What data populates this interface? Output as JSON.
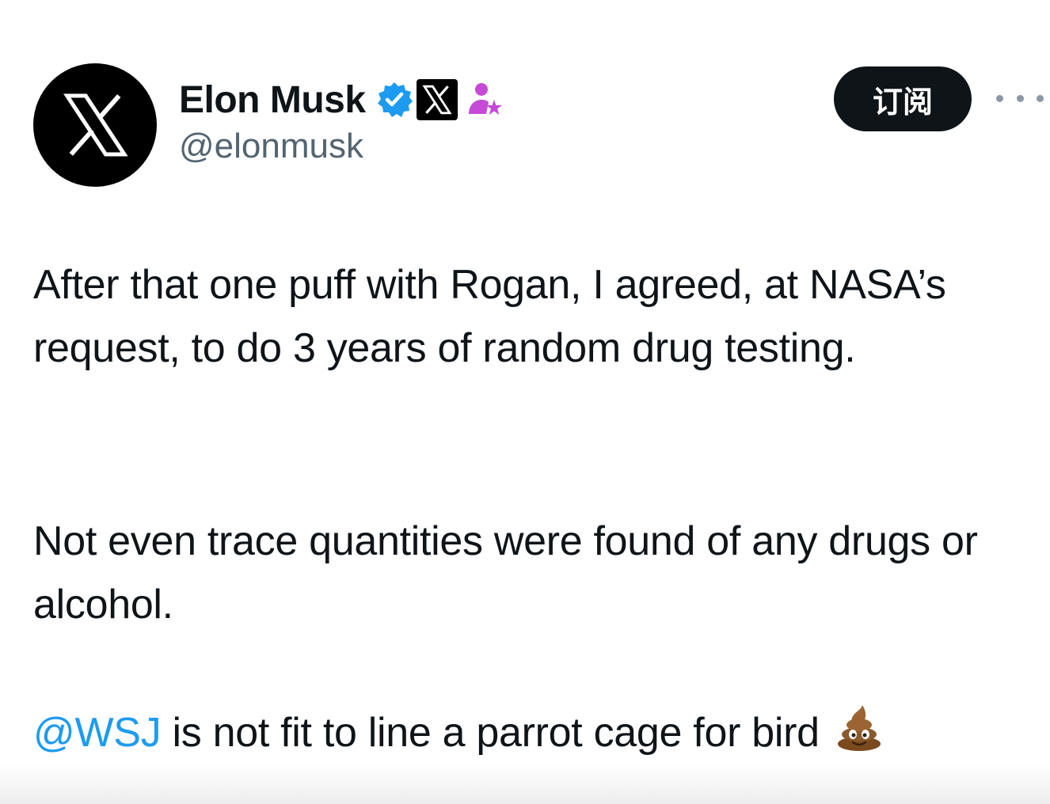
{
  "author": {
    "display_name": "Elon Musk",
    "handle": "@elonmusk",
    "avatar_icon": "x-logo-icon",
    "badges": [
      "verified-badge-icon",
      "x-affiliate-badge-icon",
      "subscription-badge-icon"
    ]
  },
  "actions": {
    "subscribe_label": "订阅",
    "more_icon": "more-options-icon"
  },
  "tweet": {
    "paragraph_1": "After that one puff with Rogan, I agreed, at NASA’s request, to do 3 years of random drug testing.",
    "paragraph_2": "Not even trace quantities were found of any drugs or alcohol.",
    "paragraph_3_mention": "@WSJ",
    "paragraph_3_text": " is not fit to line a parrot cage for bird",
    "paragraph_3_emoji": "poop-emoji-icon"
  },
  "colors": {
    "text": "#0f1419",
    "secondary": "#536471",
    "link": "#1d9bf0",
    "verified": "#1d9bf0",
    "subscription": "#c54bd6"
  }
}
